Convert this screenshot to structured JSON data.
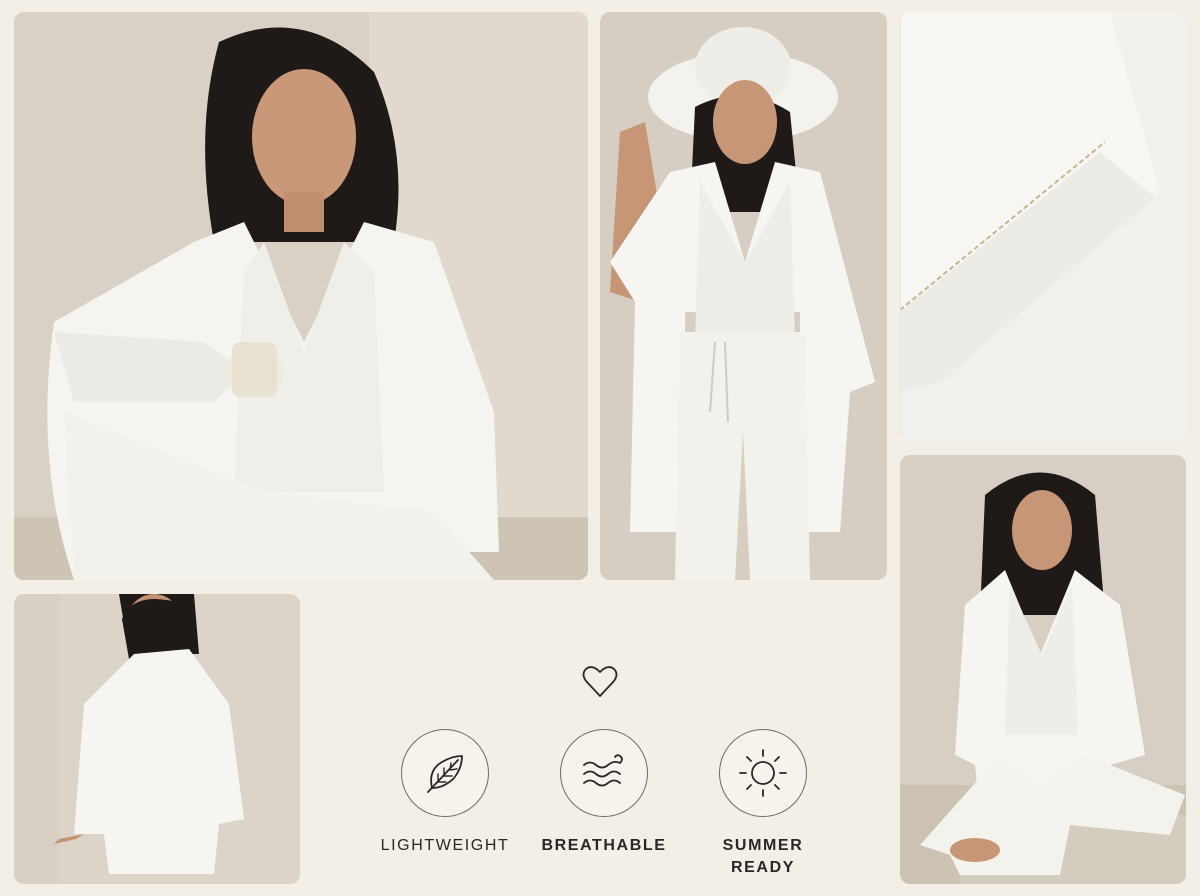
{
  "features": [
    {
      "label": "LIGHTWEIGHT",
      "icon": "leaf-icon",
      "bold": false
    },
    {
      "label": "BREATHABLE",
      "icon": "wind-waves-icon",
      "bold": true
    },
    {
      "label": "SUMMER READY",
      "icon": "sun-icon",
      "bold": true
    }
  ],
  "colors": {
    "background": "#f3efe6",
    "icon_stroke": "#2a2827",
    "wall": "#d8d0c4",
    "linen": "#f7f6f2"
  }
}
